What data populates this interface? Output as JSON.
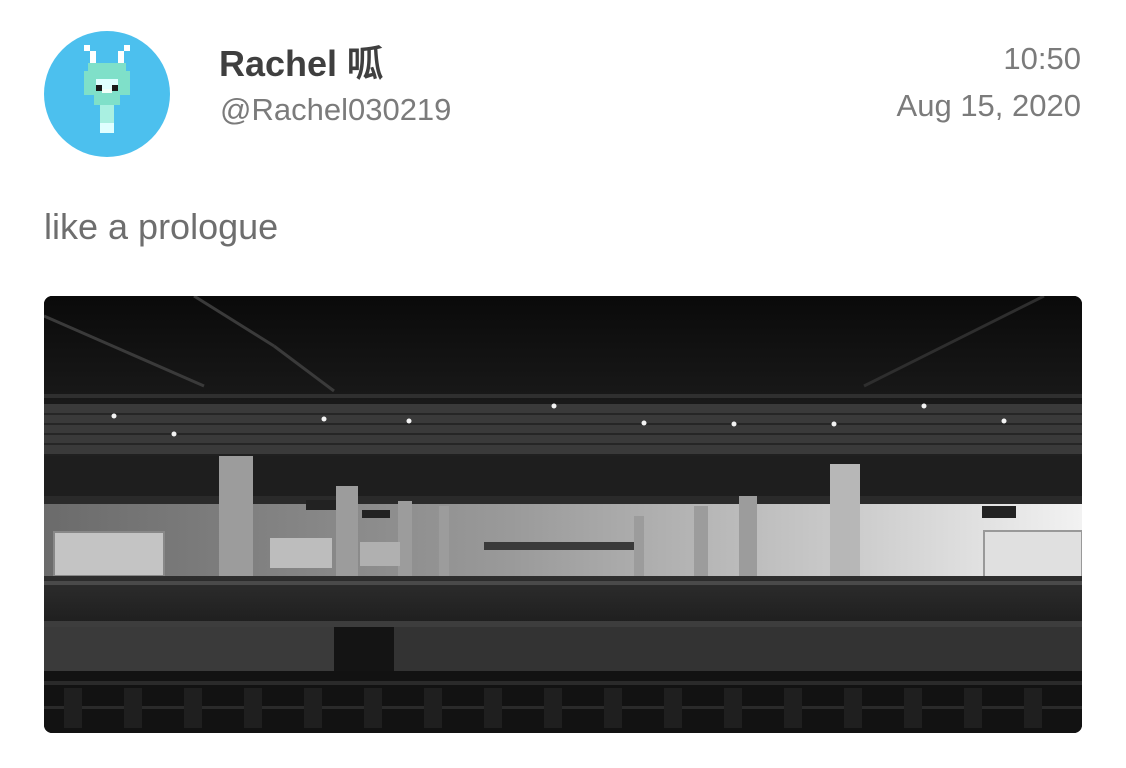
{
  "post": {
    "author_name": "Rachel 呱",
    "author_handle": "@Rachel030219",
    "time": "10:50",
    "date": "Aug 15, 2020",
    "text": "like a prologue",
    "avatar_icon": "pixel-rabbit-icon",
    "avatar_bg_color": "#4cc0ee",
    "image_description_icon": "train-station-platform-photo"
  }
}
